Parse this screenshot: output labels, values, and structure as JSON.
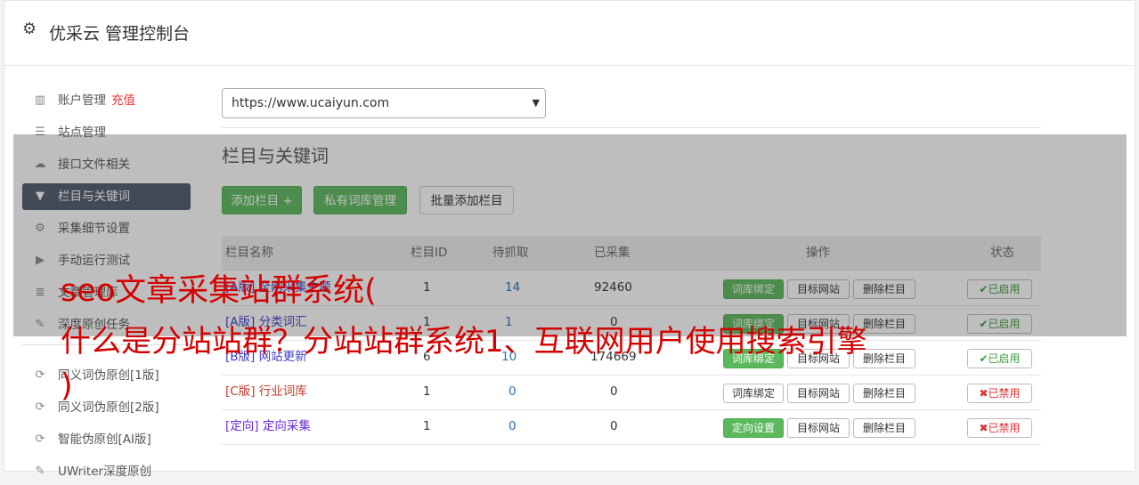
{
  "app": {
    "title": "优采云 管理控制台",
    "icon": "gear-icon"
  },
  "sidebar": {
    "items": [
      {
        "label": "账户管理",
        "badge": "充值",
        "icon": "bar-chart-icon"
      },
      {
        "label": "站点管理",
        "icon": "server-icon"
      },
      {
        "label": "接口文件相关",
        "icon": "cloud-upload-icon"
      },
      {
        "label": "栏目与关键词",
        "icon": "filter-icon",
        "active": true
      },
      {
        "label": "采集细节设置",
        "icon": "gears-icon"
      },
      {
        "label": "手动运行测试",
        "icon": "play-circle-icon"
      },
      {
        "label": "文章管理库",
        "icon": "database-icon"
      },
      {
        "label": "深度原创任务",
        "icon": "edit-icon"
      },
      {
        "label": "同义词伪原创[1版]",
        "icon": "refresh-icon"
      },
      {
        "label": "同义词伪原创[2版]",
        "icon": "refresh-icon"
      },
      {
        "label": "智能伪原创[AI版]",
        "icon": "refresh-icon"
      },
      {
        "label": "UWriter深度原创",
        "icon": "edit-icon"
      }
    ]
  },
  "main": {
    "site_select": {
      "value": "https://www.ucaiyun.com"
    },
    "section_title": "栏目与关键词",
    "buttons": {
      "add": "添加栏目 +",
      "private": "私有词库管理",
      "batch": "批量添加栏目"
    },
    "table": {
      "headers": [
        "栏目名称",
        "栏目ID",
        "待抓取",
        "已采集",
        "操作",
        "状态"
      ],
      "rows": [
        {
          "tag": "[A版]",
          "name": "全网采集主题",
          "id": "1",
          "pending": "14",
          "collected": "92460",
          "op1": "词库绑定",
          "op2": "目标网站",
          "op3": "删除栏目",
          "status": "✔已启用",
          "enabled": true
        },
        {
          "tag": "[A版]",
          "name": "分类词汇",
          "id": "1",
          "pending": "1",
          "collected": "0",
          "op1": "词库绑定",
          "op2": "目标网站",
          "op3": "删除栏目",
          "status": "✔已启用",
          "enabled": true
        },
        {
          "tag": "[B版]",
          "name": "网站更新",
          "id": "6",
          "pending": "10",
          "collected": "174669",
          "op1": "词库绑定",
          "op2": "目标网站",
          "op3": "删除栏目",
          "status": "✔已启用",
          "enabled": true
        },
        {
          "tag": "[C版]",
          "name": "行业词库",
          "id": "1",
          "pending": "0",
          "collected": "0",
          "op1": "词库绑定",
          "op2": "目标网站",
          "op3": "删除栏目",
          "status": "✖已禁用",
          "enabled": false
        },
        {
          "tag": "[定向]",
          "name": "定向采集",
          "id": "1",
          "pending": "0",
          "collected": "0",
          "op1": "定向设置",
          "op2": "目标网站",
          "op3": "删除栏目",
          "status": "✖已禁用",
          "enabled": false
        }
      ]
    }
  },
  "overlay_caption": {
    "line1": "seo文章采集站群系统(",
    "line2": "什么是分站站群？分站站群系统1、互联网用户使用搜索引擎",
    "line3": ")"
  },
  "colors": {
    "accent": "#5cb85c",
    "active_nav": "#4e5a6b",
    "caption": "#d40000",
    "danger": "#d9302f"
  }
}
